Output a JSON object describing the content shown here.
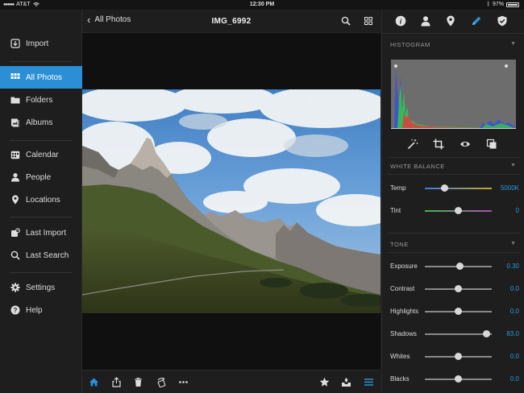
{
  "status_bar": {
    "carrier": "AT&T",
    "time": "12:30 PM",
    "battery": "97%"
  },
  "sidebar": {
    "items": [
      {
        "label": "Import",
        "icon": "import-icon"
      },
      {
        "label": "All Photos",
        "icon": "grid-icon",
        "active": true
      },
      {
        "label": "Folders",
        "icon": "folder-icon"
      },
      {
        "label": "Albums",
        "icon": "album-icon"
      },
      {
        "label": "Calendar",
        "icon": "calendar-icon"
      },
      {
        "label": "People",
        "icon": "person-icon"
      },
      {
        "label": "Locations",
        "icon": "pin-icon"
      },
      {
        "label": "Last Import",
        "icon": "last-import-icon"
      },
      {
        "label": "Last Search",
        "icon": "search-icon"
      },
      {
        "label": "Settings",
        "icon": "gear-icon"
      },
      {
        "label": "Help",
        "icon": "help-icon"
      }
    ]
  },
  "header": {
    "back_label": "All Photos",
    "title": "IMG_6992"
  },
  "panel": {
    "tabs": [
      "info-icon",
      "person-icon",
      "pin-icon",
      "pencil-icon",
      "shield-icon"
    ],
    "active_tab": "pencil-icon",
    "histogram_title": "HISTOGRAM",
    "white_balance_title": "WHITE BALANCE",
    "tone_title": "TONE",
    "white_balance": [
      {
        "label": "Temp",
        "value": "5000K",
        "level": 0.3
      },
      {
        "label": "Tint",
        "value": "0",
        "level": 0.5
      }
    ],
    "tone": [
      {
        "label": "Exposure",
        "value": "0.30",
        "level": 0.52
      },
      {
        "label": "Contrast",
        "value": "0.0",
        "level": 0.5
      },
      {
        "label": "Highlights",
        "value": "0.0",
        "level": 0.5
      },
      {
        "label": "Shadows",
        "value": "83.0",
        "level": 0.92
      },
      {
        "label": "Whites",
        "value": "0.0",
        "level": 0.5
      },
      {
        "label": "Blacks",
        "value": "0.0",
        "level": 0.5
      }
    ]
  },
  "colors": {
    "accent": "#2a8fd4",
    "value_blue": "#2a9ae0",
    "temp_track": "#c8a33a",
    "tint_track_left": "#44b54a",
    "tint_track_right": "#b04ab5"
  }
}
